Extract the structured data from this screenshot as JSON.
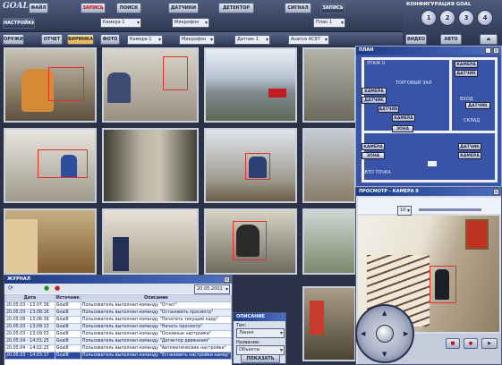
{
  "toolbar1": {
    "logo": "GOAL",
    "items": [
      "ФАЙЛ",
      "ЗАПИСЬ",
      "ПОИСК",
      "ДАТЧИКИ",
      "ДЕТЕКТОР",
      "СИГНАЛ",
      "ЗАПИСЬ"
    ],
    "camera_select": "Камера 1",
    "mic_select": "Микрофон",
    "floor_select": "План 1",
    "level_select": "Уровень 1",
    "settings": "НАСТРОЙКИ"
  },
  "toolbar2": {
    "items": [
      "ОРУЖИЕ",
      "ОТЧЕТ",
      "ВИРИНКА",
      "ФОТО"
    ],
    "camera_select": "Камера 1",
    "mic_select": "Микрофон",
    "sensor_select": "Датчик 1",
    "device_select": "Avance AC97"
  },
  "config": {
    "title": "КОНФИГУРАЦИЯ GOAL",
    "buttons": [
      "1",
      "2",
      "3",
      "4"
    ],
    "video_label": "ВИДЕО",
    "auto_label": "АВТО"
  },
  "plan": {
    "title": "ПЛАН",
    "floor_label": "ЭТАЖ 0",
    "hall_label": "ТОРГОВЫЙ ЗАЛ",
    "warehouse_label": "СКЛАД",
    "entrance_label": "ВХОД",
    "auto_label": "АВТО ТОЧКА",
    "buttons": [
      "КАМЕРА",
      "ДАТЧИК",
      "ДАТЧИК",
      "ЗОНА",
      "КАМЕРА",
      "ДАТЧИК",
      "ДАТЧИК",
      "КАМЕРА",
      "КАМЕРА",
      "ЗОНА",
      "ДАТЧИК",
      "КАМЕРА"
    ]
  },
  "viewer": {
    "title": "ПРОСМОТР - КАМЕРА 9",
    "time_value": "10",
    "zoom_label": "1"
  },
  "log": {
    "title": "ЖУРНАЛ",
    "date_select": "20.05.2002",
    "columns": [
      "Дата",
      "Источник",
      "Описание"
    ],
    "rows": [
      [
        "20.05.03 - 13:07:36",
        "Goal8",
        "Пользователь выполнил команду \"Отчет\""
      ],
      [
        "20.05.03 - 13:08:16",
        "Goal8",
        "Пользователь выполнил команду \"Остановить просмотр\""
      ],
      [
        "20.05.09 - 13:08:36",
        "Goal8",
        "Пользователь выполнил команду \"Печатать текущий кадр\""
      ],
      [
        "20.05.03 - 13:09:13",
        "Goal8",
        "Пользователь выполнил команду \"Начать просмотр\""
      ],
      [
        "20.05.03 - 13:09:53",
        "Goal8",
        "Пользователь выполнил команду \"Основные настройки\""
      ],
      [
        "20.05.04 - 14:01:25",
        "Goal8",
        "Пользователь выполнил команду \"Детектор движения\""
      ],
      [
        "20.05.04 - 14:02:25",
        "Goal8",
        "Пользователь выполнил команду \"Автоматические настройки\""
      ],
      [
        "20.05.03 - 14:03:17",
        "Goal8",
        "Пользователь выполнил команду \"Установить настройки камер\""
      ]
    ]
  },
  "small": {
    "title": "ОПИСАНИЕ",
    "type_label": "Тип:",
    "type_value": "Линия",
    "name_label": "Название:",
    "name_value": "Объекты",
    "show_button": "ПОКАЗАТЬ"
  },
  "colors": {
    "frame": "#c7cfdb",
    "detect": "#e0322a",
    "plan_bg": "#3953a7",
    "accent": "#e5b14a"
  }
}
